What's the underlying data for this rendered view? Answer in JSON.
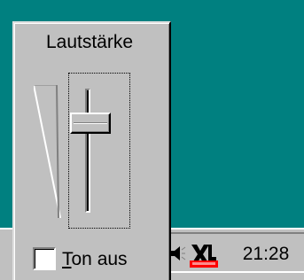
{
  "volume_popup": {
    "title": "Lautstärke",
    "volume_level_percent": 72,
    "mute": {
      "label_accel": "T",
      "label_rest": "on aus",
      "checked": false
    }
  },
  "tray": {
    "clock": "21:28",
    "icons": [
      "speaker-icon",
      "xl-app-icon"
    ]
  },
  "colors": {
    "desktop": "#008080",
    "face": "#c0c0c0",
    "xl_red": "#ff0000"
  }
}
